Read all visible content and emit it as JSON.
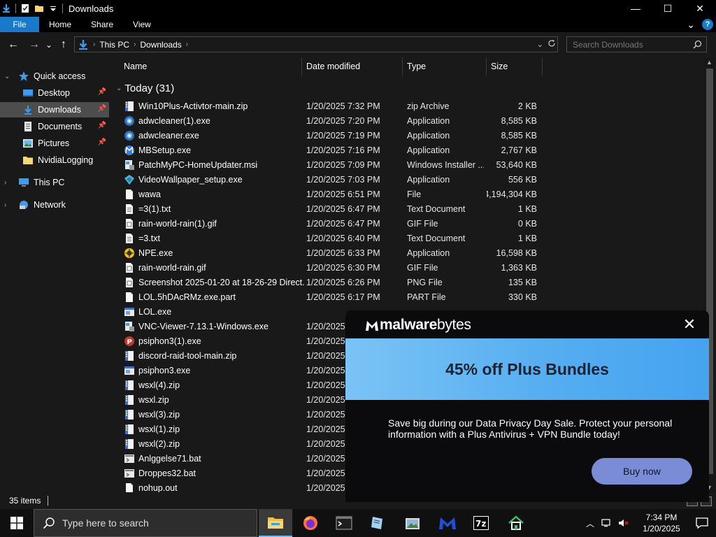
{
  "window": {
    "title": "Downloads",
    "minimize": "—",
    "maximize": "☐",
    "close": "✕"
  },
  "ribbon": {
    "tabs": [
      "File",
      "Home",
      "Share",
      "View"
    ],
    "expand": "⌄",
    "help": "?"
  },
  "nav": {
    "back": "←",
    "forward": "→",
    "recent": "⌄",
    "up": "↑",
    "breadcrumb": [
      "This PC",
      "Downloads"
    ],
    "search_placeholder": "Search Downloads"
  },
  "sidebar": {
    "quick_access": "Quick access",
    "items": [
      {
        "label": "Desktop",
        "icon": "desktop-icon",
        "pinned": true
      },
      {
        "label": "Downloads",
        "icon": "downloads-icon",
        "pinned": true,
        "selected": true
      },
      {
        "label": "Documents",
        "icon": "documents-icon",
        "pinned": true
      },
      {
        "label": "Pictures",
        "icon": "pictures-icon",
        "pinned": true
      },
      {
        "label": "NvidiaLogging",
        "icon": "folder-icon",
        "pinned": false
      }
    ],
    "this_pc": "This PC",
    "network": "Network"
  },
  "columns": {
    "name": "Name",
    "date": "Date modified",
    "type": "Type",
    "size": "Size"
  },
  "group": {
    "label": "Today (31)"
  },
  "files": [
    {
      "name": "Win10Plus-Activtor-main.zip",
      "date": "1/20/2025 7:32 PM",
      "type": "zip Archive",
      "size": "2 KB",
      "icon": "zip"
    },
    {
      "name": "adwcleaner(1).exe",
      "date": "1/20/2025 7:20 PM",
      "type": "Application",
      "size": "8,585 KB",
      "icon": "adw"
    },
    {
      "name": "adwcleaner.exe",
      "date": "1/20/2025 7:19 PM",
      "type": "Application",
      "size": "8,585 KB",
      "icon": "adw"
    },
    {
      "name": "MBSetup.exe",
      "date": "1/20/2025 7:16 PM",
      "type": "Application",
      "size": "2,767 KB",
      "icon": "mb"
    },
    {
      "name": "PatchMyPC-HomeUpdater.msi",
      "date": "1/20/2025 7:09 PM",
      "type": "Windows Installer ...",
      "size": "53,640 KB",
      "icon": "msi"
    },
    {
      "name": "VideoWallpaper_setup.exe",
      "date": "1/20/2025 7:03 PM",
      "type": "Application",
      "size": "556 KB",
      "icon": "vw"
    },
    {
      "name": "wawa",
      "date": "1/20/2025 6:51 PM",
      "type": "File",
      "size": "4,194,304 KB",
      "icon": "blank"
    },
    {
      "name": "=3(1).txt",
      "date": "1/20/2025 6:47 PM",
      "type": "Text Document",
      "size": "1 KB",
      "icon": "txt"
    },
    {
      "name": "rain-world-rain(1).gif",
      "date": "1/20/2025 6:47 PM",
      "type": "GIF File",
      "size": "0 KB",
      "icon": "img"
    },
    {
      "name": "=3.txt",
      "date": "1/20/2025 6:40 PM",
      "type": "Text Document",
      "size": "1 KB",
      "icon": "txt"
    },
    {
      "name": "NPE.exe",
      "date": "1/20/2025 6:33 PM",
      "type": "Application",
      "size": "16,598 KB",
      "icon": "npe"
    },
    {
      "name": "rain-world-rain.gif",
      "date": "1/20/2025 6:30 PM",
      "type": "GIF File",
      "size": "1,363 KB",
      "icon": "img"
    },
    {
      "name": "Screenshot 2025-01-20 at 18-26-29 Direct...",
      "date": "1/20/2025 6:26 PM",
      "type": "PNG File",
      "size": "135 KB",
      "icon": "img"
    },
    {
      "name": "LOL.5hDAcRMz.exe.part",
      "date": "1/20/2025 6:17 PM",
      "type": "PART File",
      "size": "330 KB",
      "icon": "blank"
    },
    {
      "name": "LOL.exe",
      "date": "",
      "type": "",
      "size": "",
      "icon": "app"
    },
    {
      "name": "VNC-Viewer-7.13.1-Windows.exe",
      "date": "1/20/2025",
      "type": "",
      "size": "",
      "icon": "msi"
    },
    {
      "name": "psiphon3(1).exe",
      "date": "1/20/2025",
      "type": "",
      "size": "",
      "icon": "psi"
    },
    {
      "name": "discord-raid-tool-main.zip",
      "date": "1/20/2025",
      "type": "",
      "size": "",
      "icon": "zip"
    },
    {
      "name": "psiphon3.exe",
      "date": "1/20/2025",
      "type": "",
      "size": "",
      "icon": "app"
    },
    {
      "name": "wsxl(4).zip",
      "date": "1/20/2025",
      "type": "",
      "size": "",
      "icon": "zip"
    },
    {
      "name": "wsxl.zip",
      "date": "1/20/2025",
      "type": "",
      "size": "",
      "icon": "zip"
    },
    {
      "name": "wsxl(3).zip",
      "date": "1/20/2025",
      "type": "",
      "size": "",
      "icon": "zip"
    },
    {
      "name": "wsxl(1).zip",
      "date": "1/20/2025",
      "type": "",
      "size": "",
      "icon": "zip"
    },
    {
      "name": "wsxl(2).zip",
      "date": "1/20/2025",
      "type": "",
      "size": "",
      "icon": "zip"
    },
    {
      "name": "Anlggelse71.bat",
      "date": "1/20/2025",
      "type": "",
      "size": "",
      "icon": "bat"
    },
    {
      "name": "Droppes32.bat",
      "date": "1/20/2025",
      "type": "",
      "size": "",
      "icon": "bat"
    },
    {
      "name": "nohup.out",
      "date": "1/20/2025",
      "type": "",
      "size": "",
      "icon": "blank"
    }
  ],
  "status": {
    "count": "35 items"
  },
  "popup": {
    "brand_prefix": "malware",
    "brand_suffix": "bytes",
    "close": "✕",
    "headline": "45% off Plus Bundles",
    "body": "Save big during our Data Privacy Day Sale. Protect your personal information with a Plus Antivirus + VPN Bundle today!",
    "cta": "Buy now",
    "colors": {
      "banner": "#56aef0",
      "button": "#7b8cd6"
    }
  },
  "taskbar": {
    "search_placeholder": "Type here to search",
    "apps": [
      "file-explorer",
      "firefox",
      "terminal",
      "notepad",
      "image-viewer",
      "malwarebytes",
      "7zip",
      "home-app"
    ],
    "time": "7:34 PM",
    "date": "1/20/2025"
  }
}
